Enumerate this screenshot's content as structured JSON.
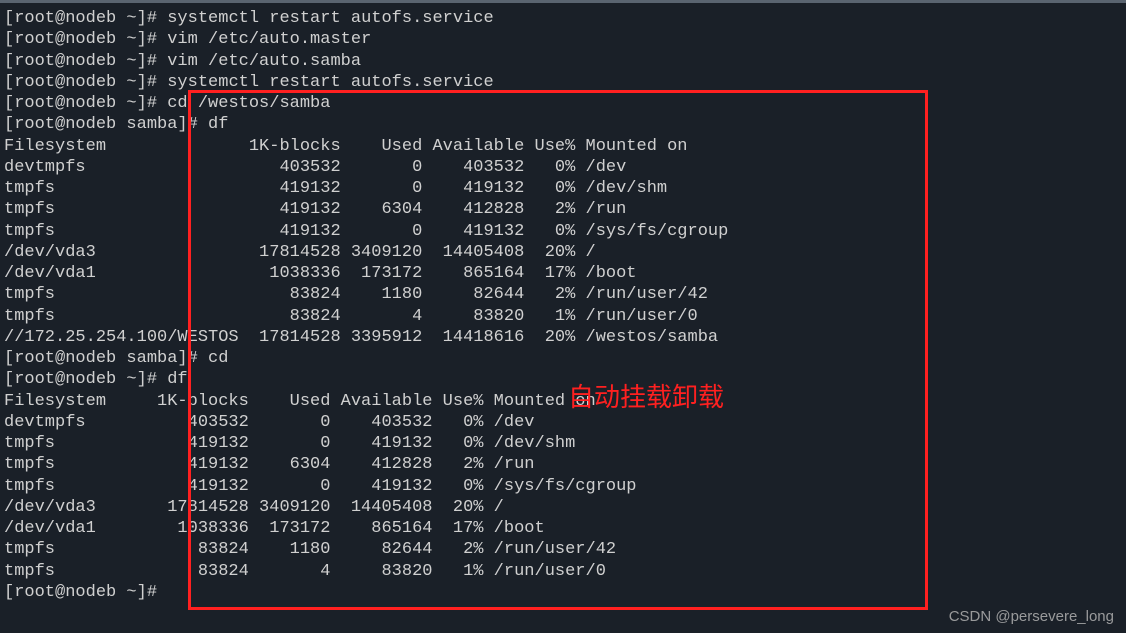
{
  "lines": {
    "l1_prompt": "[root@nodeb ~]# ",
    "l1_cmd": "systemctl restart autofs.service",
    "l2_prompt": "[root@nodeb ~]# ",
    "l2_cmd": "vim /etc/auto.master",
    "l3_prompt": "[root@nodeb ~]# ",
    "l3_cmd": "vim /etc/auto.samba",
    "l4_prompt": "[root@nodeb ~]# ",
    "l4_cmd": "systemctl restart autofs.service",
    "l5_prompt": "[root@nodeb ~]# ",
    "l5_cmd": "cd /westos/samba",
    "l6_prompt": "[root@nodeb samba]# ",
    "l6_cmd": "df",
    "df1_header": "Filesystem              1K-blocks    Used Available Use% Mounted on",
    "df1_row1": "devtmpfs                   403532       0    403532   0% /dev",
    "df1_row2": "tmpfs                      419132       0    419132   0% /dev/shm",
    "df1_row3": "tmpfs                      419132    6304    412828   2% /run",
    "df1_row4": "tmpfs                      419132       0    419132   0% /sys/fs/cgroup",
    "df1_row5": "/dev/vda3                17814528 3409120  14405408  20% /",
    "df1_row6": "/dev/vda1                 1038336  173172    865164  17% /boot",
    "df1_row7": "tmpfs                       83824    1180     82644   2% /run/user/42",
    "df1_row8": "tmpfs                       83824       4     83820   1% /run/user/0",
    "df1_row9": "//172.25.254.100/WESTOS  17814528 3395912  14418616  20% /westos/samba",
    "l7_prompt": "[root@nodeb samba]# ",
    "l7_cmd": "cd",
    "l8_prompt": "[root@nodeb ~]# ",
    "l8_cmd": "df",
    "df2_header": "Filesystem     1K-blocks    Used Available Use% Mounted on",
    "df2_row1": "devtmpfs          403532       0    403532   0% /dev",
    "df2_row2": "tmpfs             419132       0    419132   0% /dev/shm",
    "df2_row3": "tmpfs             419132    6304    412828   2% /run",
    "df2_row4": "tmpfs             419132       0    419132   0% /sys/fs/cgroup",
    "df2_row5": "/dev/vda3       17814528 3409120  14405408  20% /",
    "df2_row6": "/dev/vda1        1038336  173172    865164  17% /boot",
    "df2_row7": "tmpfs              83824    1180     82644   2% /run/user/42",
    "df2_row8": "tmpfs              83824       4     83820   1% /run/user/0",
    "l9_prompt": "[root@nodeb ~]# "
  },
  "annotation_text": "自动挂载卸载",
  "watermark_text": "CSDN @persevere_long"
}
